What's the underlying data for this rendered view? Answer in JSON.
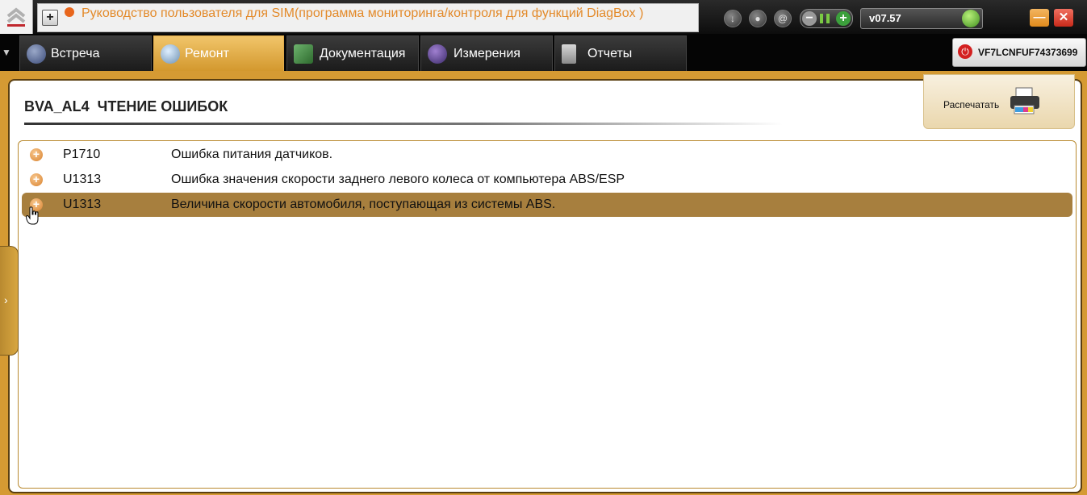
{
  "brand": {
    "icon": "citroen-logo-icon"
  },
  "message": {
    "text": "Руководство пользователя для SIM(программа мониторинга/контроля для  функций DiagBox )"
  },
  "top_icons": [
    "download-icon",
    "user-icon",
    "email-icon"
  ],
  "version": "v07.57",
  "tabs": [
    {
      "label": "Встреча",
      "icon": "meeting-icon",
      "active": false
    },
    {
      "label": "Ремонт",
      "icon": "magnifier-icon",
      "active": true
    },
    {
      "label": "Документация",
      "icon": "book-icon",
      "active": false
    },
    {
      "label": "Измерения",
      "icon": "waveform-icon",
      "active": false
    },
    {
      "label": "Отчеты",
      "icon": "report-icon",
      "active": false
    }
  ],
  "vin": "VF7LCNFUF74373699",
  "page": {
    "title": "BVA_AL4  ЧТЕНИЕ ОШИБОК",
    "print_label": "Распечатать"
  },
  "faults": [
    {
      "code": "P1710",
      "description": "Ошибка питания датчиков.",
      "selected": false
    },
    {
      "code": "U1313",
      "description": "Ошибка значения скорости заднего левого колеса от компьютера ABS/ESP",
      "selected": false
    },
    {
      "code": "U1313",
      "description": "Величина скорости автомобиля, поступающая из системы ABS.",
      "selected": true
    }
  ],
  "colors": {
    "accent": "#d59a33",
    "selected_row": "#a77f3e",
    "message_text": "#e38a2a"
  }
}
